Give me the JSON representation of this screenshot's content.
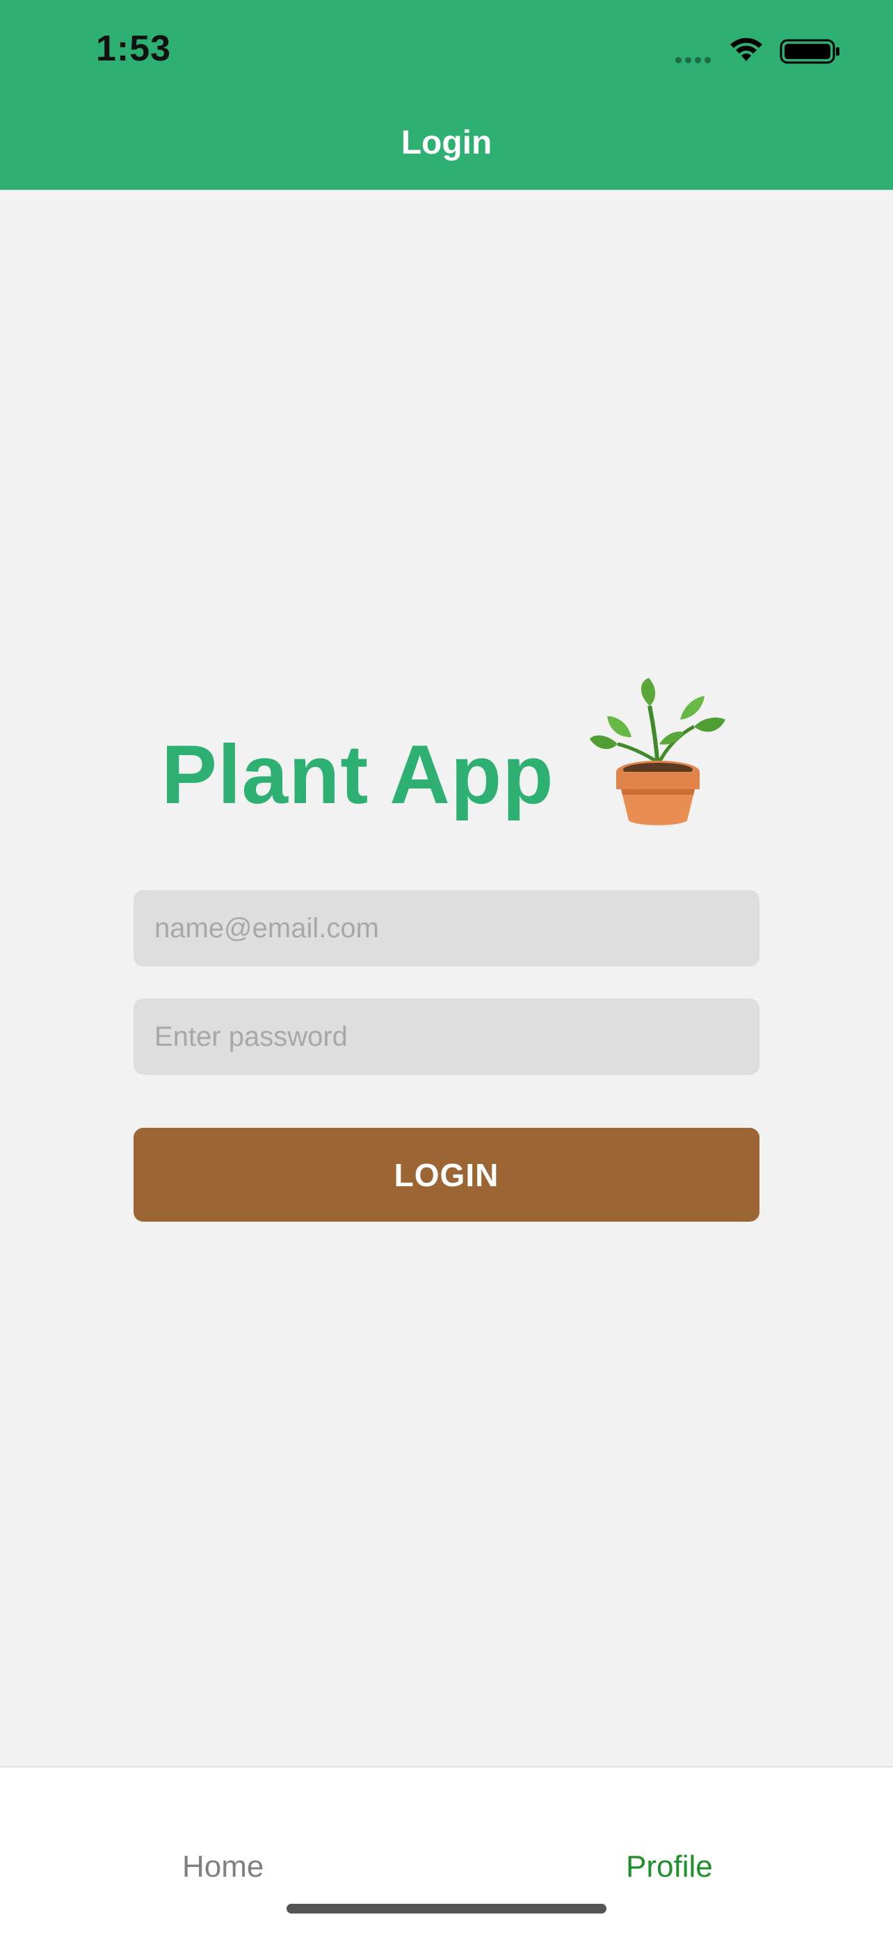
{
  "status_bar": {
    "time": "1:53"
  },
  "header": {
    "title": "Login"
  },
  "brand": {
    "title": "Plant App"
  },
  "form": {
    "email_placeholder": "name@email.com",
    "password_placeholder": "Enter password",
    "login_label": "LOGIN"
  },
  "tabbar": {
    "tabs": [
      {
        "label": "Home",
        "active": false
      },
      {
        "label": "Profile",
        "active": true
      }
    ]
  },
  "colors": {
    "header": "#2db072",
    "brand": "#2db072",
    "button": "#9b6634",
    "active_tab": "#1f8f2b",
    "inactive_tab": "#808080"
  },
  "icons": [
    "signal-icon",
    "wifi-icon",
    "battery-icon",
    "potted-plant-icon"
  ]
}
